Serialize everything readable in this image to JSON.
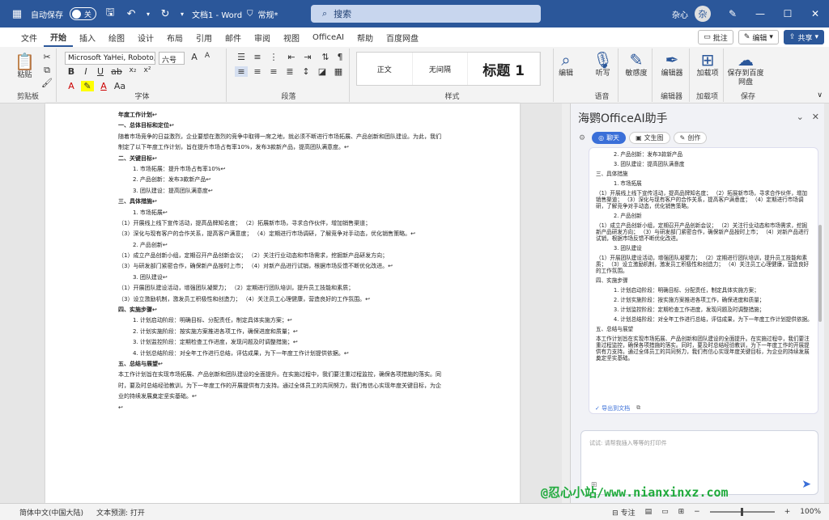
{
  "titlebar": {
    "autosave_label": "自动保存",
    "autosave_state": "关",
    "doc_title": "文档1 - Word",
    "doc_status": "常规*",
    "search_placeholder": "搜索",
    "user_name": "杂心",
    "avatar_initial": "杂"
  },
  "menu": {
    "tabs": [
      "文件",
      "开始",
      "插入",
      "绘图",
      "设计",
      "布局",
      "引用",
      "邮件",
      "审阅",
      "视图",
      "OfficeAI",
      "帮助",
      "百度网盘"
    ],
    "comment_btn": "批注",
    "edit_btn": "编辑",
    "share_btn": "共享"
  },
  "ribbon": {
    "clipboard": {
      "paste": "粘贴",
      "group": "剪贴板"
    },
    "font": {
      "name": "Microsoft YaHei, Roboto, S",
      "size": "六号",
      "group": "字体"
    },
    "paragraph": {
      "group": "段落"
    },
    "styles": {
      "items": [
        "正文",
        "无间隔",
        "标题 1"
      ],
      "group": "样式"
    },
    "editing": {
      "label": "编辑"
    },
    "voice": {
      "label": "听写",
      "group": "语音"
    },
    "sensitivity": {
      "label": "敏感度"
    },
    "editor": {
      "label": "编辑器",
      "group": "编辑器"
    },
    "addins": {
      "label": "加载项",
      "group": "加载项"
    },
    "save": {
      "label": "保存到百度网盘",
      "group": "保存"
    }
  },
  "document": {
    "lines": [
      {
        "text": "年度工作计划↩",
        "indent": 0,
        "bold": true
      },
      {
        "text": "一、总体目标和定位↩",
        "indent": 0,
        "bold": true
      },
      {
        "text": "随着市场竞争的日益激烈，企业要想在激烈的竞争中取得一席之地，就必须不断进行市场拓展、产品创新和团队建设。为此，我们",
        "indent": 0
      },
      {
        "text": "制定了以下年度工作计划，旨在提升市场占有率10%，发布3款新产品，提高团队满意度。↩",
        "indent": 0
      },
      {
        "text": "二、关键目标↩",
        "indent": 0,
        "bold": true
      },
      {
        "text": "1.      市场拓展：提升市场占有率10%↩",
        "indent": 18
      },
      {
        "text": "2.      产品创新：发布3款新产品↩",
        "indent": 18
      },
      {
        "text": "3.      团队建设：提高团队满意度↩",
        "indent": 18
      },
      {
        "text": "三、具体措施↩",
        "indent": 0,
        "bold": true
      },
      {
        "text": "1.      市场拓展↩",
        "indent": 18
      },
      {
        "text": "（1）开展线上线下宣传活动，提高品牌知名度；  （2）拓展新市场，寻求合作伙伴，增加销售渠道；",
        "indent": 0
      },
      {
        "text": "（3）深化与现有客户的合作关系，提高客户满意度；  （4）定期进行市场调研，了解竞争对手动态，优化销售策略。↩",
        "indent": 0
      },
      {
        "text": "2.      产品创新↩",
        "indent": 18
      },
      {
        "text": "（1）成立产品创新小组，定期召开产品创新会议；  （2）关注行业动态和市场需求，挖掘新产品研发方向；",
        "indent": 0
      },
      {
        "text": "（3）与研发部门紧密合作，确保新产品按时上市；  （4）对新产品进行试销，根据市场反馈不断优化改进。↩",
        "indent": 0
      },
      {
        "text": "3.      团队建设↩",
        "indent": 18
      },
      {
        "text": "（1）开展团队建设活动，增强团队凝聚力；  （2）定期进行团队培训，提升员工技能和素质；",
        "indent": 0
      },
      {
        "text": "（3）设立激励机制，激发员工积极性和创造力；  （4）关注员工心理健康，营造良好的工作氛围。↩",
        "indent": 0
      },
      {
        "text": "四、实施步骤↩",
        "indent": 0,
        "bold": true
      },
      {
        "text": "1.      计划启动阶段：明确目标、分配责任，制定具体实施方案；↩",
        "indent": 18
      },
      {
        "text": "2.      计划实施阶段：按实施方案推进各项工作，确保进度和质量；↩",
        "indent": 18
      },
      {
        "text": "3.      计划监控阶段：定期检查工作进度，发现问题及时调整措施；↩",
        "indent": 18
      },
      {
        "text": "4.      计划总结阶段：对全年工作进行总结，评估成果，为下一年度工作计划提供依据。↩",
        "indent": 18
      },
      {
        "text": "五、总结与展望↩",
        "indent": 0,
        "bold": true
      },
      {
        "text": "本工作计划旨在实现市场拓展、产品创新和团队建设的全面提升。在实施过程中，我们要注重过程监控，确保各项措施的落实。同",
        "indent": 0
      },
      {
        "text": "时，要及时总结经验教训，为下一年度工作的开展提供有力支持。通过全体员工的共同努力，我们有信心实现年度关键目标，为企",
        "indent": 0
      },
      {
        "text": "业的持续发展奠定坚实基础。↩",
        "indent": 0
      },
      {
        "text": "↩",
        "indent": 0
      }
    ]
  },
  "panel": {
    "title": "海鹦OfficeAI助手",
    "tabs": [
      "聊天",
      "文生图",
      "创作"
    ],
    "chat_lines": [
      {
        "text": "2.      产品创新：发布3款新产品",
        "li": true
      },
      {
        "text": "3.      团队建设：提高团队满意度",
        "li": true
      },
      {
        "text": "三、具体措施",
        "li": false
      },
      {
        "text": "1.      市场拓展",
        "li": true
      },
      {
        "text": "（1）开展线上线下宣传活动，提高品牌知名度；  （2）拓展新市场，寻求合作伙伴，增加销售渠道；  （3）深化与现有客户的合作关系，提高客户满意度；  （4）定期进行市场调研，了解竞争对手动态，优化销售策略。",
        "li": false
      },
      {
        "text": "2.      产品创新",
        "li": true
      },
      {
        "text": "（1）成立产品创新小组，定期召开产品创新会议；  （2）关注行业动态和市场需求，挖掘新产品研发方向；  （3）与研发部门紧密合作，确保新产品按时上市；  （4）对新产品进行试销，根据市场反馈不断优化改进。",
        "li": false
      },
      {
        "text": "3.      团队建设",
        "li": true
      },
      {
        "text": "（1）开展团队建设活动，增强团队凝聚力；  （2）定期进行团队培训，提升员工技能和素质；  （3）设立激励机制，激发员工积极性和创造力；  （4）关注员工心理健康，营造良好的工作氛围。",
        "li": false
      },
      {
        "text": "四、实施步骤",
        "li": false
      },
      {
        "text": "1.      计划启动阶段：明确目标、分配责任，制定具体实施方案；",
        "li": true
      },
      {
        "text": "2.      计划实施阶段：按实施方案推进各项工作，确保进度和质量；",
        "li": true
      },
      {
        "text": "3.      计划监控阶段：定期检查工作进度，发现问题及时调整措施；",
        "li": true
      },
      {
        "text": "4.      计划总结阶段：对全年工作进行总结，评估成果，为下一年度工作计划提供依据。",
        "li": true
      },
      {
        "text": "五、总结与展望",
        "li": false
      },
      {
        "text": "本工作计划旨在实现市场拓展、产品创新和团队建设的全面提升。在实施过程中，我们要注重过程监控，确保各项措施的落实。同时，要及时总结经验教训，为下一年度工作的开展提供有力支持。通过全体员工的共同努力，我们有信心实现年度关键目标，为企业的持续发展奠定坚实基础。",
        "li": false
      }
    ],
    "export_label": "导出到文档",
    "input_placeholder": "试试: 请帮我插入等等的打印件"
  },
  "status": {
    "language": "简体中文(中国大陆)",
    "prediction": "文本预测: 打开",
    "focus": "专注",
    "zoom": "100%"
  },
  "watermark": "@忍心小站/www.nianxinxz.com",
  "colors": {
    "accent": "#2b579a",
    "ai_blue": "#3a6fd8",
    "watermark": "#1faa3c"
  }
}
